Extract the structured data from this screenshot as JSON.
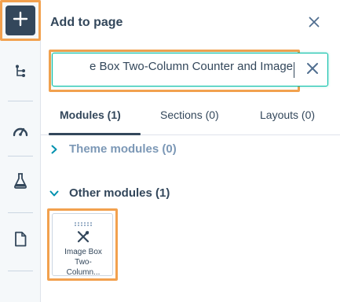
{
  "rail": {
    "add_button_icon": "plus-icon",
    "items": [
      {
        "icon": "tree-structure-icon"
      },
      {
        "icon": "gauge-icon"
      },
      {
        "icon": "flask-icon"
      },
      {
        "icon": "document-icon"
      }
    ]
  },
  "panel": {
    "title": "Add to page",
    "close_icon": "close-icon"
  },
  "search": {
    "value": "Image Box Two-Column Counter and Image",
    "visible_text": "e Box Two-Column Counter and Image",
    "clear_icon": "close-icon"
  },
  "tabs": [
    {
      "label": "Modules (1)",
      "active": true
    },
    {
      "label": "Sections (0)",
      "active": false
    },
    {
      "label": "Layouts (0)",
      "active": false
    }
  ],
  "sections": {
    "theme_modules": {
      "label": "Theme modules (0)",
      "expanded": false
    },
    "other_modules": {
      "label": "Other modules (1)",
      "expanded": true
    }
  },
  "module_card": {
    "label_line1": "Image Box",
    "label_line2": "Two-",
    "label_line3": "Column...",
    "icon": "wrench-screwdriver-icon"
  },
  "colors": {
    "accent_outline": "#f2a14e",
    "focus_teal": "#00bda5",
    "dark_navy": "#33475b",
    "muted": "#7c98b6"
  }
}
